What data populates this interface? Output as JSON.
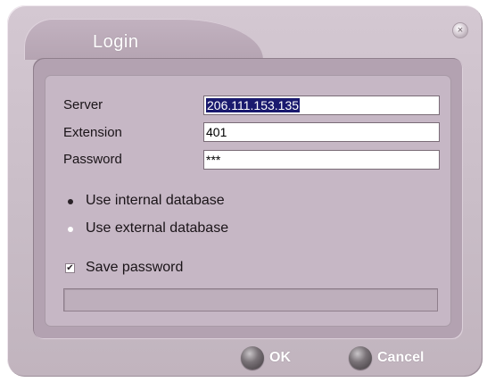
{
  "window": {
    "title": "Login",
    "close_glyph": "×"
  },
  "form": {
    "server_label": "Server",
    "server_value": "206.111.153.135",
    "extension_label": "Extension",
    "extension_value": "401",
    "password_label": "Password",
    "password_value": "***"
  },
  "database": {
    "options": [
      {
        "label": "Use internal database",
        "selected": true
      },
      {
        "label": "Use external database",
        "selected": false
      }
    ]
  },
  "save_password": {
    "label": "Save password",
    "checked": true,
    "check_glyph": "✔"
  },
  "buttons": {
    "ok_label": "OK",
    "cancel_label": "Cancel"
  },
  "icons": {
    "close": "close-icon",
    "ok": "orb-icon",
    "cancel": "orb-icon"
  }
}
